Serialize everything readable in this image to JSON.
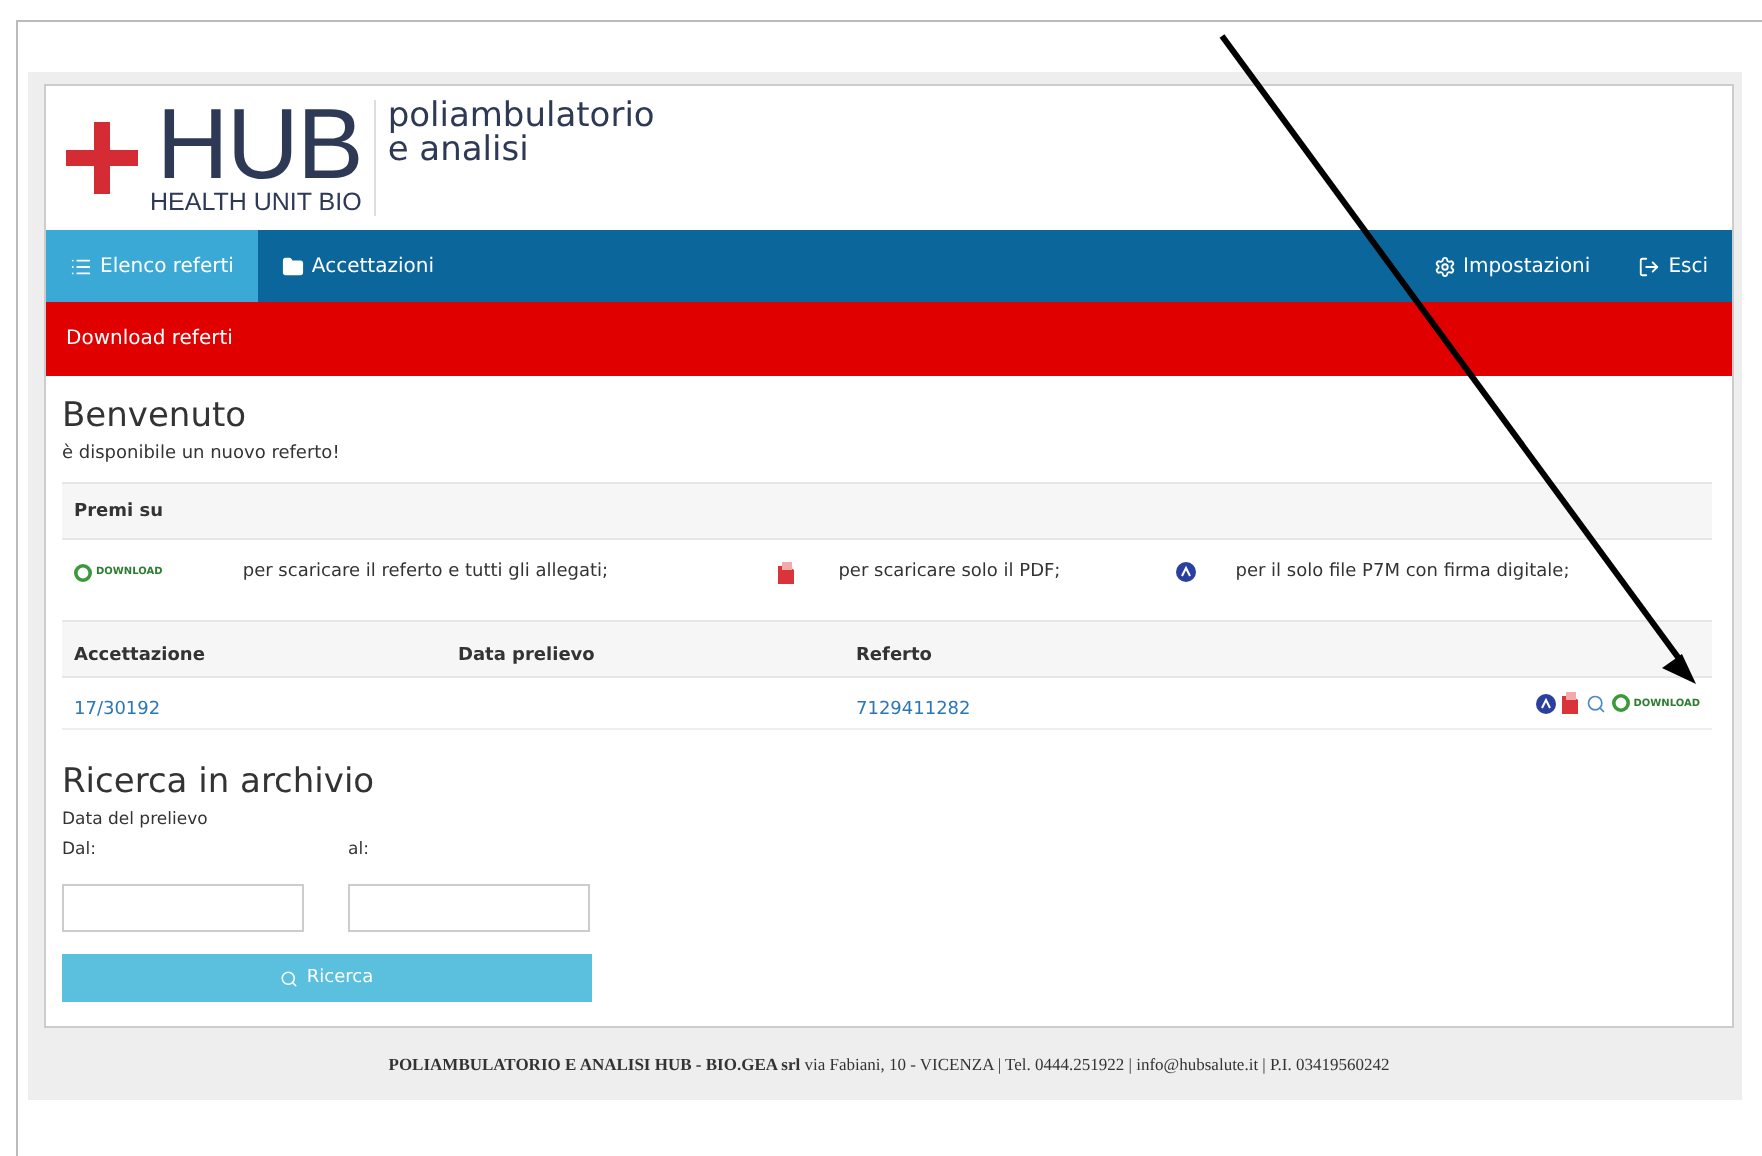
{
  "logo": {
    "mark": "HUB",
    "subtitle": "HEALTH UNIT BIO",
    "tagline": [
      "poliambulatorio",
      "e analisi"
    ]
  },
  "nav": {
    "left": [
      {
        "label": "Elenco referti",
        "kind": "list",
        "selected": true
      },
      {
        "label": "Accettazioni",
        "kind": "folder",
        "selected": false
      }
    ],
    "right": [
      {
        "label": "Impostazioni",
        "kind": "gear"
      },
      {
        "label": "Esci",
        "kind": "exit"
      }
    ]
  },
  "banner": "Download referti",
  "welcome": {
    "title": "Benvenuto",
    "message": "è disponibile un nuovo referto!"
  },
  "legend": {
    "title": "Premi su",
    "items": [
      {
        "kind": "download",
        "badge": "DOWNLOAD",
        "text": "per scaricare il referto e tutti gli allegati;"
      },
      {
        "kind": "pdf",
        "text": "per scaricare solo il PDF;"
      },
      {
        "kind": "p7m",
        "text": "per il solo file P7M con firma digitale;"
      }
    ]
  },
  "table": {
    "columns": [
      "Accettazione",
      "Data prelievo",
      "Referto"
    ],
    "rows": [
      {
        "acceptance": "17/30192",
        "report": "7129411282",
        "actions": [
          {
            "kind": "p7m"
          },
          {
            "kind": "pdf"
          },
          {
            "kind": "search"
          },
          {
            "kind": "download",
            "badge": "DOWNLOAD"
          }
        ]
      }
    ]
  },
  "search": {
    "title": "Ricerca in archivio",
    "label": "Data del prelievo",
    "fields": [
      {
        "label": "Dal:"
      },
      {
        "label": "al:"
      }
    ],
    "button": "Ricerca"
  },
  "footer": "**POLIAMBULATORIO E ANALISI HUB - BIO.GEA srl** via Fabiani, 10 - VICENZA | Tel. 0444.251922 | info@hubsalute.it | P.I. 03419560242"
}
